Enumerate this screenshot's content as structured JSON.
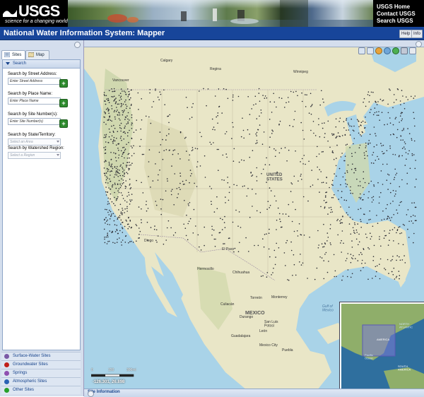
{
  "header": {
    "logo_text": "USGS",
    "logo_tagline": "science for a changing world",
    "links": [
      "USGS Home",
      "Contact USGS",
      "Search USGS"
    ]
  },
  "titlebar": {
    "title": "National Water Information System: Mapper",
    "buttons": [
      "Help",
      "Info"
    ]
  },
  "sidebar": {
    "tabs": [
      {
        "label": "Sites",
        "icon": "list-icon",
        "active": true
      },
      {
        "label": "Map",
        "icon": "map-icon",
        "active": false
      }
    ],
    "panel_title": "Search",
    "fields": [
      {
        "label": "Search by Street Address:",
        "placeholder": "Enter Street Address",
        "type": "text"
      },
      {
        "label": "Search by Place Name:",
        "placeholder": "Enter Place Name",
        "type": "text"
      },
      {
        "label": "Search by Site Number(s):",
        "placeholder": "Enter Site Number(s)",
        "type": "text"
      },
      {
        "label": "Search by State/Territory:",
        "placeholder": "Select an Area",
        "type": "select"
      },
      {
        "label": "Search by Watershed Region:",
        "placeholder": "Select a Region",
        "type": "select"
      }
    ],
    "site_types": [
      {
        "label": "Surface-Water Sites",
        "color": "#7b5aa6"
      },
      {
        "label": "Groundwater Sites",
        "color": "#c0201a"
      },
      {
        "label": "Springs",
        "color": "#8f4fb0"
      },
      {
        "label": "Atmospheric Sites",
        "color": "#2a62b5"
      },
      {
        "label": "Other Sites",
        "color": "#26a02b"
      }
    ]
  },
  "map": {
    "labels": {
      "calgary": "Calgary",
      "regina": "Regina",
      "winnipeg": "Winnipeg",
      "vancouver": "Vancouver",
      "united_states": "UNITED\nSTATES",
      "hermosillo": "Hermosillo",
      "chihuahua": "Chihuahua",
      "mexico": "MEXICO",
      "monterrey": "Monterrey",
      "torreon": "Torreón",
      "culiacan": "Culiacán",
      "durango": "Durango",
      "san_luis_potosi": "San Luis\nPotosí",
      "leon": "León",
      "guadalajara": "Guadalajara",
      "mexico_city": "Mexico City",
      "puebla": "Puebla",
      "gulf_of_mexico": "Gulf of\nMexico",
      "diego": "Diego",
      "el_paso": "El Paso"
    },
    "inset_labels": {
      "north_atlantic": "NORTH\nATLANTIC",
      "pacific": "Pacific\nOcean",
      "south_america": "SOUTH\nAMERICA",
      "america": "AMERICA"
    },
    "scale": {
      "labels": [
        "0",
        "150",
        "300mi"
      ]
    },
    "coordinates": "-126.301, 26.898",
    "tools": [
      "zoom-in-box-icon",
      "zoom-out-box-icon",
      "previous-extent-icon",
      "next-extent-icon",
      "full-extent-icon",
      "pan-icon",
      "identify-icon"
    ]
  },
  "site_info": {
    "title": "Site Information"
  },
  "colors": {
    "title_bar": "#17459a",
    "panel_bg": "#d4deed",
    "site_markers": "#2b2b33"
  }
}
